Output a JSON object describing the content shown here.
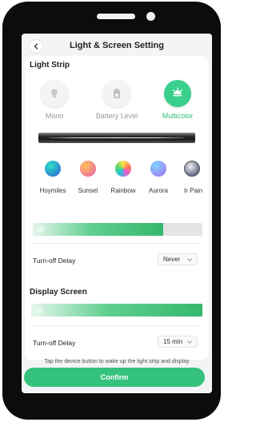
{
  "header": {
    "title": "Light & Screen Setting"
  },
  "light_strip": {
    "title": "Light Strip",
    "modes": [
      {
        "label": "Mono",
        "icon": "bulb-icon",
        "active": false
      },
      {
        "label": "Battery Level",
        "icon": "battery-icon",
        "active": false
      },
      {
        "label": "Multicolor",
        "icon": "multicolor-light-icon",
        "active": true
      }
    ],
    "effects": [
      {
        "label": "Hoymiles",
        "colors": [
          "#1fc9c2",
          "#2a5fd8"
        ]
      },
      {
        "label": "Sunset",
        "colors": [
          "#ffb25a",
          "#e85bb0"
        ]
      },
      {
        "label": "Rainbow",
        "colors": [
          "#ffe04a",
          "#22c4d8"
        ]
      },
      {
        "label": "Aurora",
        "colors": [
          "#7fd3ff",
          "#a56cf2"
        ]
      },
      {
        "label": "Ir Pain",
        "colors": [
          "#dfe0ee",
          "#6b6f88"
        ]
      }
    ],
    "brightness": 0.77,
    "turn_off_delay": {
      "label": "Turn-off Delay",
      "value": "Never"
    }
  },
  "display_screen": {
    "title": "Display Screen",
    "brightness": 1.0,
    "turn_off_delay": {
      "label": "Turn-off Delay",
      "value": "15 min"
    }
  },
  "hint": "Tap the device button to wake up the light strip and display",
  "confirm_label": "Confirm",
  "colors": {
    "accent": "#35c27c",
    "active_label": "#2fbf7a"
  }
}
